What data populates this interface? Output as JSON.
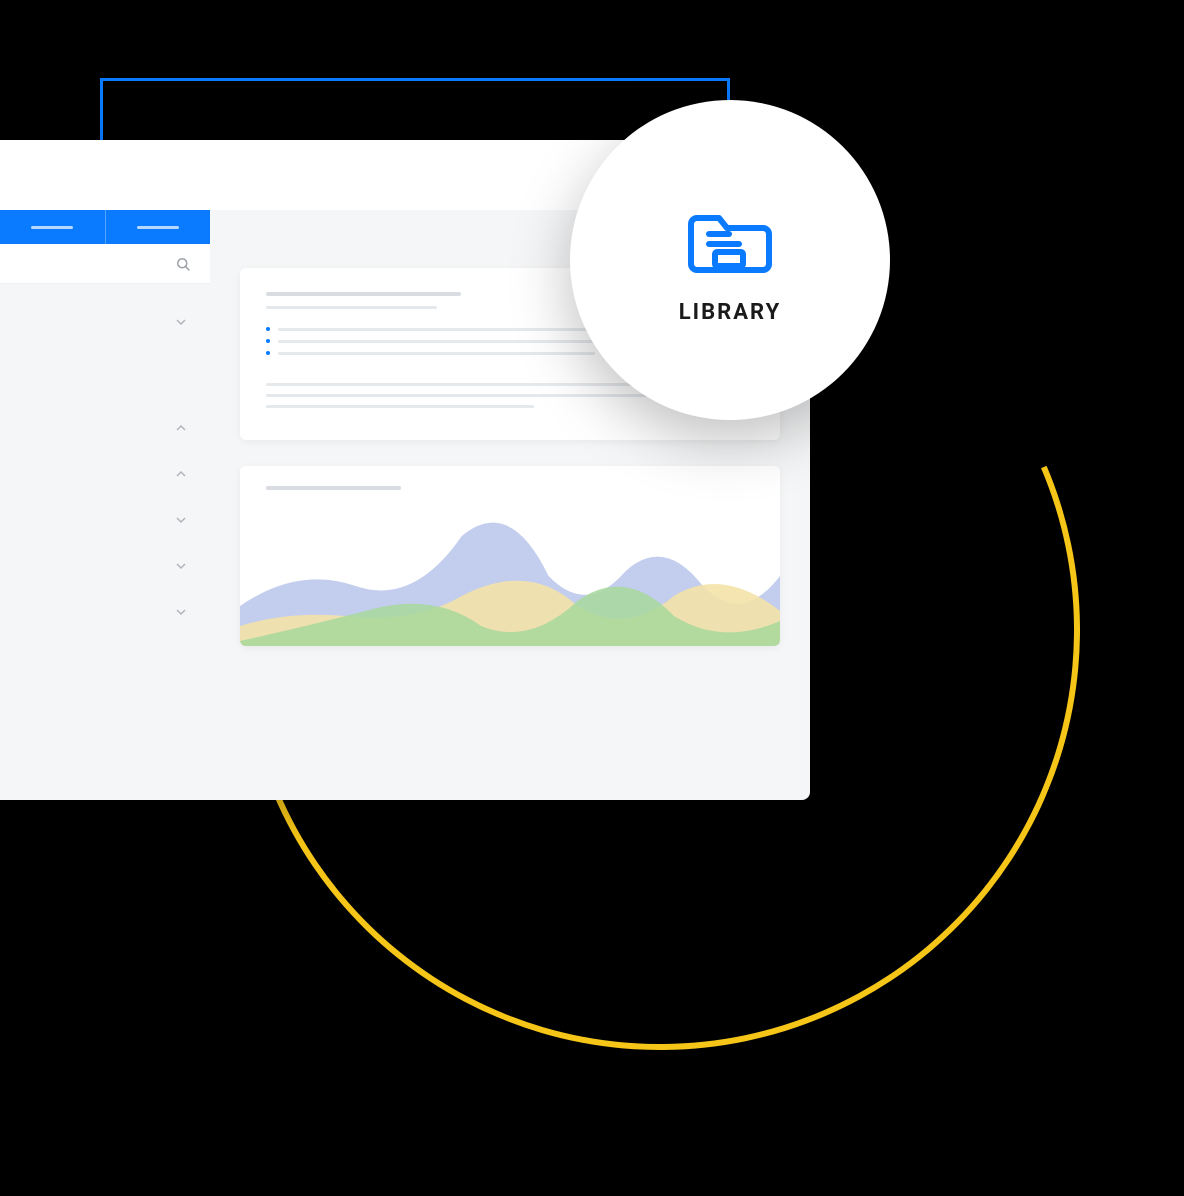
{
  "callout": {
    "label": "LIBRARY",
    "icon": "library-folder-icon"
  },
  "header": {
    "icons": [
      "handshake-icon",
      "timer-icon",
      "cloud-icon",
      "play-icon"
    ],
    "menu": "menu-icon"
  },
  "tabs": [
    "tab-1",
    "tab-2"
  ],
  "sidebar": {
    "search_placeholder": "",
    "items": [
      {
        "dir": "down"
      },
      {
        "dir": "up"
      },
      {
        "dir": "up"
      },
      {
        "dir": "down"
      },
      {
        "dir": "down"
      },
      {
        "dir": "down"
      }
    ]
  },
  "colors": {
    "accent": "#0a7aff",
    "arc": "#f5c518",
    "chart_blue": "#b8c4ea",
    "chart_green": "#a8d89b",
    "chart_yellow": "#f4e2a8"
  }
}
